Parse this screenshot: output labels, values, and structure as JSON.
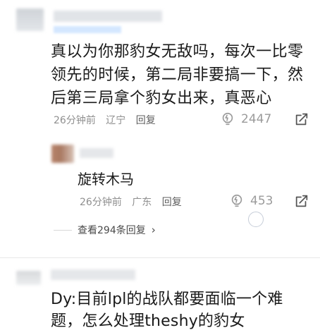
{
  "comment_main": {
    "text": "真以为你那豹女无敌吗，每次一比零领先的时候，第二局非要搞一下，然后第三局拿个豹女出来，真恶心",
    "time": "26分钟前",
    "location": "辽宁",
    "reply_label": "回复",
    "likes": "2447"
  },
  "reply_top": {
    "text": "旋转木马",
    "time": "26分钟前",
    "location": "广东",
    "reply_label": "回复",
    "likes": "453"
  },
  "view_replies": {
    "label": "查看294条回复",
    "chevron": "›"
  },
  "comment_second": {
    "text": "Dy:目前lpl的战队都要面临一个难题，怎么处理theshy的豹女"
  },
  "icons": {
    "like": "lightbulb-like-icon",
    "share": "share-icon"
  },
  "colors": {
    "meta": "#8f8f8f",
    "text": "#1a1a1a",
    "like": "#9b9b9b",
    "highlight": "#d4e7ff"
  }
}
